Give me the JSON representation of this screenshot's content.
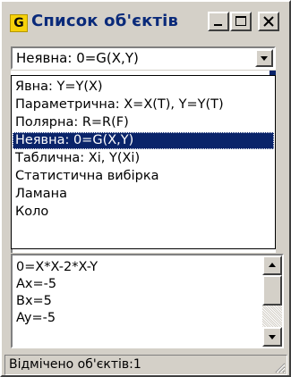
{
  "window": {
    "title": "Список об'єктів",
    "app_icon_letter": "G",
    "controls": [
      "minimize",
      "maximize",
      "close"
    ]
  },
  "curve_type_select": {
    "selected": "Неявна: 0=G(X,Y)",
    "options": [
      "Явна: Y=Y(X)",
      "Параметрична:  X=X(T), Y=Y(T)",
      "Полярна: R=R(F)",
      "Неявна: 0=G(X,Y)",
      "Таблична: Xi, Y(Xi)",
      "Статистична вибірка",
      "Ламана",
      "Коло"
    ],
    "highlighted_index": 3
  },
  "object_details": {
    "lines": [
      "0=X*X-2*X-Y",
      "Ax=-5",
      "Bx=5",
      "Ay=-5"
    ]
  },
  "status": {
    "text": "Відмічено об'єктів:1"
  },
  "colors": {
    "selection": "#0a246a",
    "face": "#d4d0c8",
    "title_text": "#0a2a7a",
    "icon": "#f6d10a"
  }
}
